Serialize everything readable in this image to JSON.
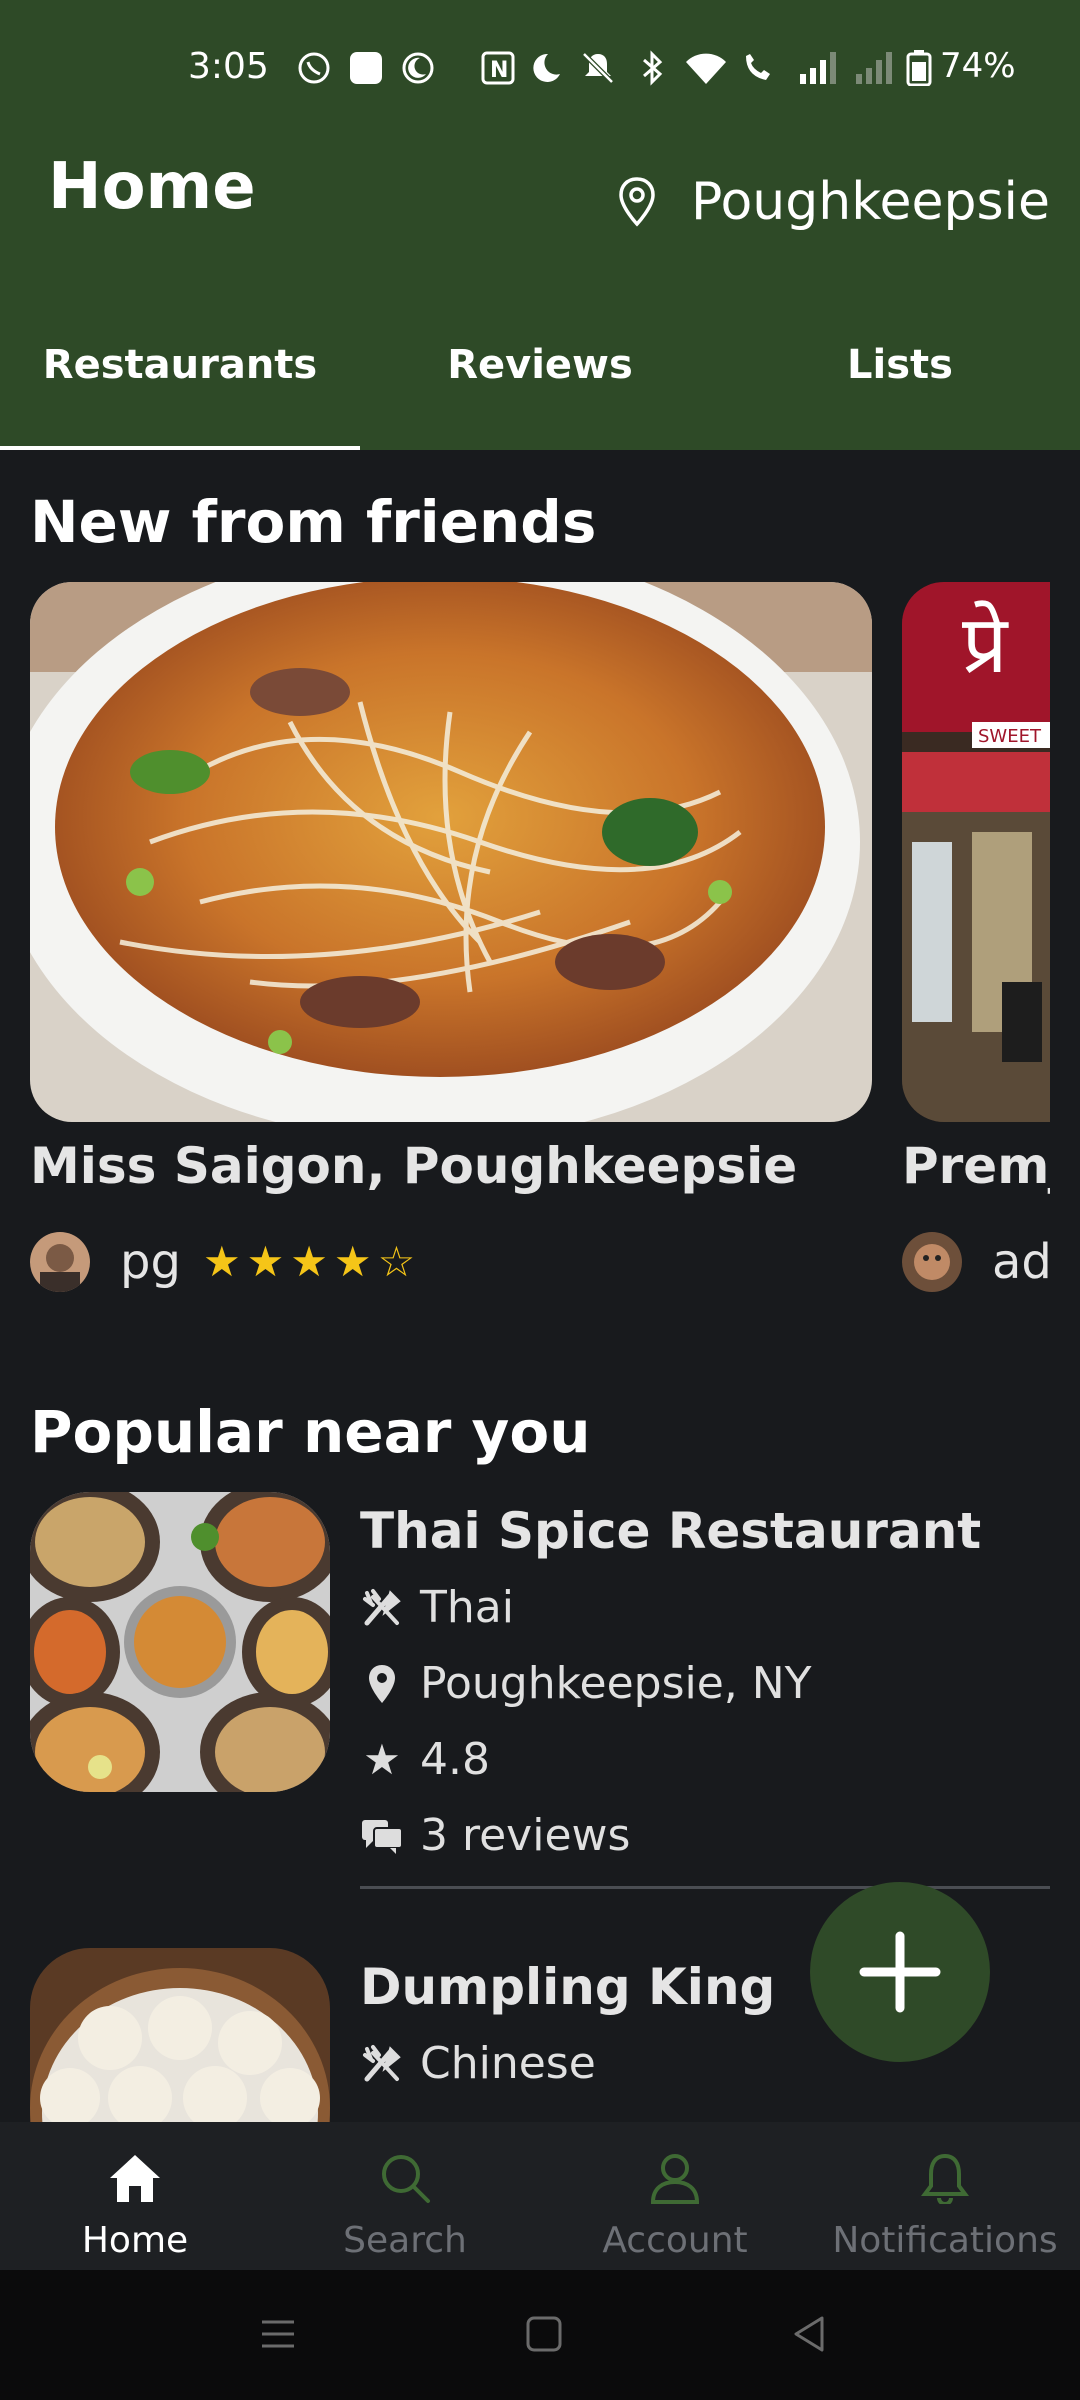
{
  "status_bar": {
    "time": "3:05",
    "battery": "74%"
  },
  "header": {
    "title": "Home",
    "location": "Poughkeepsie"
  },
  "tabs": [
    {
      "label": "Restaurants",
      "active": true
    },
    {
      "label": "Reviews",
      "active": false
    },
    {
      "label": "Lists",
      "active": false
    }
  ],
  "friends_section": {
    "title": "New from friends",
    "cards": [
      {
        "name": "Miss Saigon, Poughkeepsie",
        "user": "pg",
        "rating": 4,
        "max_rating": 5
      },
      {
        "name": "Premj",
        "user": "ad"
      }
    ]
  },
  "popular_section": {
    "title": "Popular near you",
    "items": [
      {
        "name": "Thai Spice Restaurant",
        "cuisine": "Thai",
        "location": "Poughkeepsie, NY",
        "rating": "4.8",
        "reviews": "3 reviews"
      },
      {
        "name": "Dumpling King",
        "cuisine": "Chinese"
      }
    ]
  },
  "fab": {
    "icon": "plus-icon"
  },
  "bottom_nav": [
    {
      "label": "Home",
      "icon": "home-icon",
      "active": true
    },
    {
      "label": "Search",
      "icon": "search-icon",
      "active": false
    },
    {
      "label": "Account",
      "icon": "account-icon",
      "active": false
    },
    {
      "label": "Notifications",
      "icon": "bell-icon",
      "active": false
    }
  ],
  "colors": {
    "header_green": "#2e4a27",
    "background": "#181a1d",
    "star_yellow": "#f5c518",
    "nav_inactive": "#6d7076"
  }
}
